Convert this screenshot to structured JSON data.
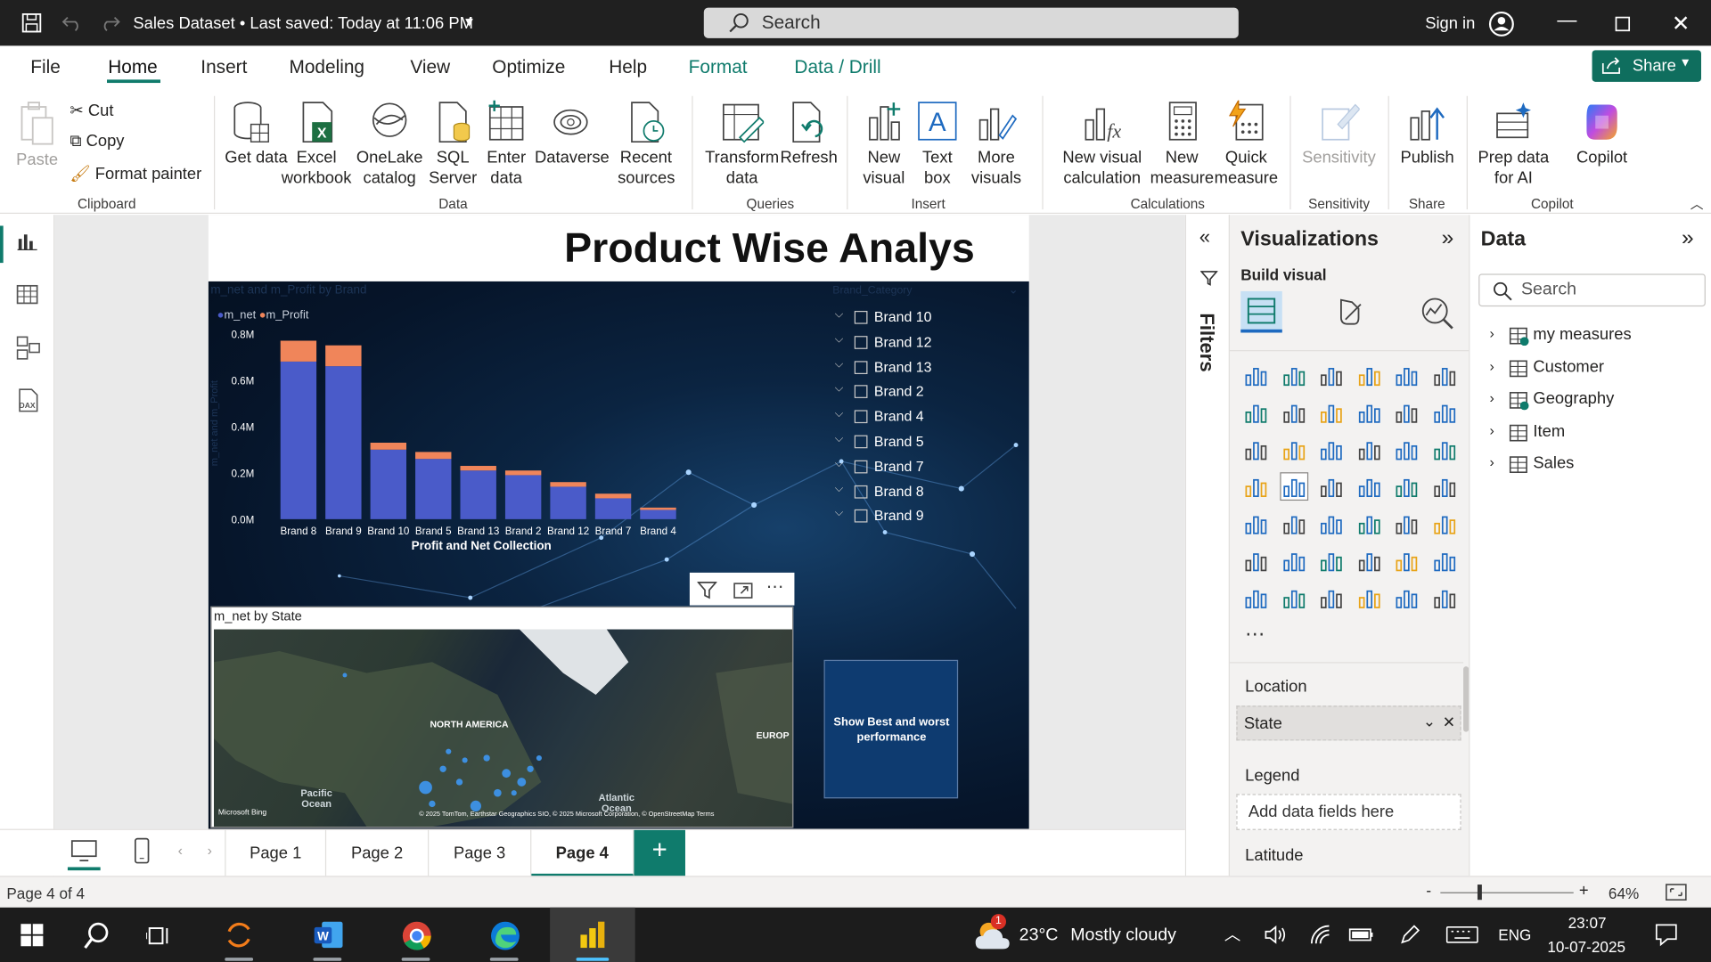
{
  "titlebar": {
    "doc_title": "Sales Dataset • Last saved: Today at 11:06 PM",
    "search": "Search",
    "sign_in": "Sign in"
  },
  "ribbon_tabs": [
    "File",
    "Home",
    "Insert",
    "Modeling",
    "View",
    "Optimize",
    "Help",
    "Format",
    "Data / Drill"
  ],
  "share_label": "Share",
  "ribbon": {
    "clipboard": {
      "paste": "Paste",
      "cut": "Cut",
      "copy": "Copy",
      "format_painter": "Format painter",
      "group": "Clipboard"
    },
    "data": {
      "get_data": "Get data",
      "excel": "Excel workbook",
      "onelake": "OneLake catalog",
      "sql": "SQL Server",
      "enter": "Enter data",
      "dataverse": "Dataverse",
      "recent": "Recent sources",
      "group": "Data"
    },
    "queries": {
      "transform": "Transform data",
      "refresh": "Refresh",
      "group": "Queries"
    },
    "insert": {
      "new_visual": "New visual",
      "text_box": "Text box",
      "more_visuals": "More visuals",
      "group": "Insert"
    },
    "calculations": {
      "new_visual_calc": "New visual calculation",
      "new_measure": "New measure",
      "quick_measure": "Quick measure",
      "group": "Calculations"
    },
    "sensitivity": {
      "label": "Sensitivity",
      "group": "Sensitivity"
    },
    "share": {
      "publish": "Publish",
      "group": "Share"
    },
    "copilot": {
      "prep": "Prep data for AI",
      "copilot": "Copilot",
      "group": "Copilot"
    }
  },
  "report": {
    "title": "Product Wise Analys",
    "chart_title": "m_net and m_Profit by Brand",
    "slicer_title": "Brand_Category",
    "slicer_items": [
      "Brand 10",
      "Brand 12",
      "Brand 13",
      "Brand 2",
      "Brand 4",
      "Brand 5",
      "Brand 7",
      "Brand 8",
      "Brand 9"
    ],
    "map_title": "m_net by State",
    "map_labels": {
      "na": "NORTH AMERICA",
      "europe": "EUROP",
      "pacific": "Pacific Ocean",
      "atlantic": "Atlantic Ocean",
      "bing": "Microsoft Bing",
      "attribution": "© 2025 TomTom, Earthstar Geographics SIO, © 2025 Microsoft Corporation, © OpenStreetMap Terms"
    },
    "best_button": "Show Best and worst performance"
  },
  "chart_data": {
    "type": "bar",
    "stacked": true,
    "title": "m_net and m_Profit by Brand",
    "xlabel": "Profit and Net Collection",
    "ylabel": "m_net and m_Profit",
    "categories": [
      "Brand 8",
      "Brand 9",
      "Brand 10",
      "Brand 5",
      "Brand 13",
      "Brand 2",
      "Brand 12",
      "Brand 7",
      "Brand 4"
    ],
    "series": [
      {
        "name": "m_net",
        "color": "#4a5bc9",
        "values": [
          0.68,
          0.66,
          0.3,
          0.26,
          0.21,
          0.19,
          0.14,
          0.09,
          0.04
        ]
      },
      {
        "name": "m_Profit",
        "color": "#f0855a",
        "values": [
          0.09,
          0.09,
          0.03,
          0.03,
          0.02,
          0.02,
          0.02,
          0.02,
          0.01
        ]
      }
    ],
    "yticks": [
      "0.0M",
      "0.2M",
      "0.4M",
      "0.6M",
      "0.8M"
    ],
    "ylim": [
      0,
      0.8
    ],
    "legend": "top-left"
  },
  "filters_label": "Filters",
  "visualizations": {
    "title": "Visualizations",
    "build": "Build visual",
    "location_label": "Location",
    "location_value": "State",
    "legend_label": "Legend",
    "legend_placeholder": "Add data fields here",
    "latitude_label": "Latitude"
  },
  "data_pane": {
    "title": "Data",
    "search_placeholder": "Search",
    "tables": [
      "my measures",
      "Customer",
      "Geography",
      "Item",
      "Sales"
    ]
  },
  "pages": [
    "Page 1",
    "Page 2",
    "Page 3",
    "Page 4"
  ],
  "status": {
    "page": "Page 4 of 4",
    "zoom": "64%"
  },
  "taskbar": {
    "weather_temp": "23°C",
    "weather_text": "Mostly cloudy",
    "lang": "ENG",
    "time": "23:07",
    "date": "10-07-2025",
    "badge": "1"
  }
}
